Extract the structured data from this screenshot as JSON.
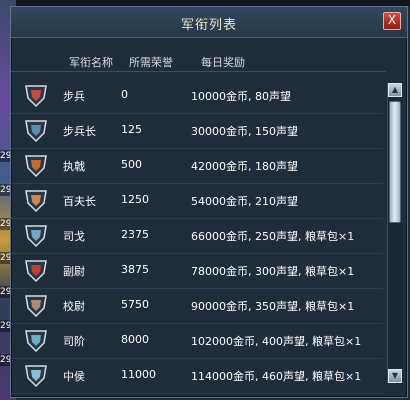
{
  "panel": {
    "title": "军衔列表",
    "close_label": "X"
  },
  "columns": {
    "name": "军衔名称",
    "honor": "所需荣誉",
    "reward": "每日奖励"
  },
  "left_tags": [
    "29",
    "29",
    "29",
    "29",
    "29",
    "29",
    "29"
  ],
  "ranks": [
    {
      "name": "步兵",
      "honor": "0",
      "reward": "10000金币, 80声望",
      "icon": "shield-badge-icon",
      "color": "#c0503a"
    },
    {
      "name": "步兵长",
      "honor": "125",
      "reward": "30000金币, 150声望",
      "icon": "shield-badge-icon",
      "color": "#5a8fb0"
    },
    {
      "name": "执戟",
      "honor": "500",
      "reward": "42000金币, 180声望",
      "icon": "spear-badge-icon",
      "color": "#c86a2a"
    },
    {
      "name": "百夫长",
      "honor": "1250",
      "reward": "54000金币, 210声望",
      "icon": "centurion-badge-icon",
      "color": "#c98a4a"
    },
    {
      "name": "司戈",
      "honor": "2375",
      "reward": "66000金币, 250声望, 粮草包×1",
      "icon": "sige-badge-icon",
      "color": "#6fa8c8"
    },
    {
      "name": "副尉",
      "honor": "3875",
      "reward": "78000金币, 300声望, 粮草包×1",
      "icon": "deputy-badge-icon",
      "color": "#c0402a"
    },
    {
      "name": "校尉",
      "honor": "5750",
      "reward": "90000金币, 350声望, 粮草包×1",
      "icon": "xiaowei-badge-icon",
      "color": "#b08a70"
    },
    {
      "name": "司阶",
      "honor": "8000",
      "reward": "102000金币, 400声望, 粮草包×1",
      "icon": "sijie-badge-icon",
      "color": "#6ab0c8"
    },
    {
      "name": "中侯",
      "honor": "11000",
      "reward": "114000金币, 460声望, 粮草包×1",
      "icon": "zhonghou-badge-icon",
      "color": "#8cc0d8"
    }
  ]
}
